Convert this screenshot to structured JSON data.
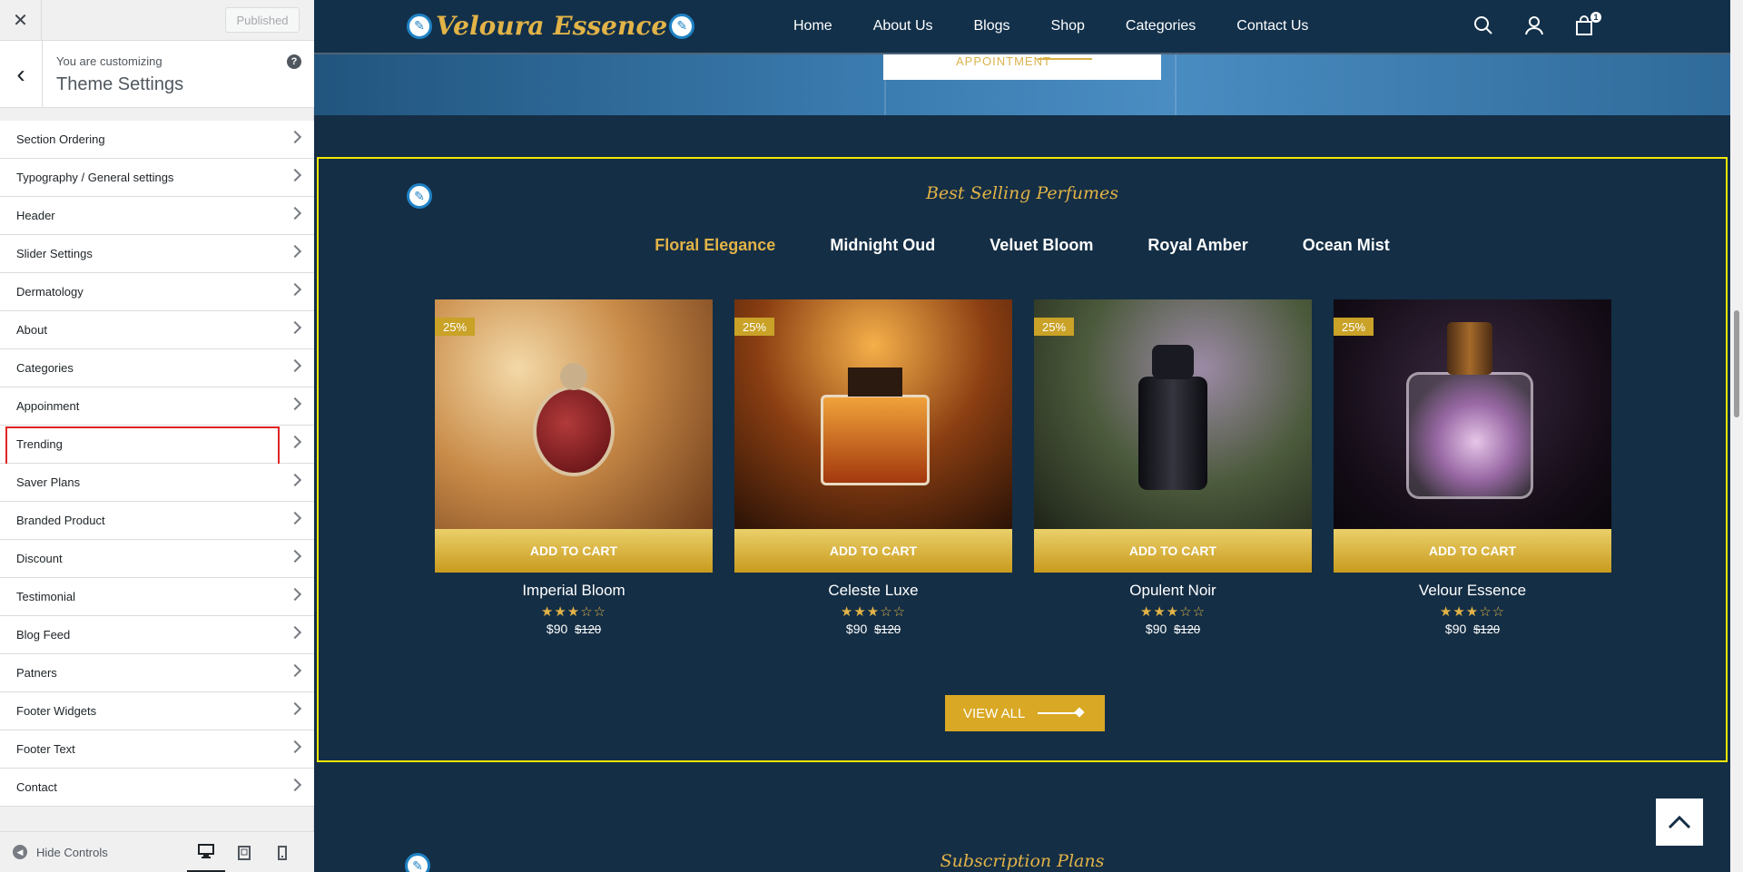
{
  "customizer": {
    "close_label": "✕",
    "published_label": "Published",
    "back_label": "‹",
    "customizing_label": "You are customizing",
    "theme_title": "Theme Settings",
    "help_label": "?",
    "sections": [
      {
        "label": "Section Ordering"
      },
      {
        "label": "Typography / General settings"
      },
      {
        "label": "Header"
      },
      {
        "label": "Slider Settings"
      },
      {
        "label": "Dermatology"
      },
      {
        "label": "About"
      },
      {
        "label": "Categories"
      },
      {
        "label": "Appoinment"
      },
      {
        "label": "Trending",
        "highlighted": true
      },
      {
        "label": "Saver Plans"
      },
      {
        "label": "Branded Product"
      },
      {
        "label": "Discount"
      },
      {
        "label": "Testimonial"
      },
      {
        "label": "Blog Feed"
      },
      {
        "label": "Patners"
      },
      {
        "label": "Footer Widgets"
      },
      {
        "label": "Footer Text"
      },
      {
        "label": "Contact"
      }
    ],
    "hide_controls_label": "Hide Controls",
    "devices": [
      "desktop-icon",
      "tablet-icon",
      "mobile-icon"
    ]
  },
  "site": {
    "logo": "Veloura Essence",
    "nav": [
      "Home",
      "About Us",
      "Blogs",
      "Shop",
      "Categories",
      "Contact Us"
    ],
    "cart_count": "1",
    "appointment_label": "APPOINTMENT",
    "colors": {
      "navy": "#142e45",
      "gold": "#e2b347",
      "highlight": "#f2e600"
    }
  },
  "best_selling": {
    "title": "Best Selling Perfumes",
    "tabs": [
      "Floral Elegance",
      "Midnight Oud",
      "Veluet Bloom",
      "Royal Amber",
      "Ocean Mist"
    ],
    "active_tab": "Floral Elegance",
    "products": [
      {
        "name": "Imperial Bloom",
        "discount": "25%",
        "add_to_cart": "ADD TO CART",
        "rating": 3,
        "price": "$90",
        "old_price": "$120"
      },
      {
        "name": "Celeste Luxe",
        "discount": "25%",
        "add_to_cart": "ADD TO CART",
        "rating": 3,
        "price": "$90",
        "old_price": "$120"
      },
      {
        "name": "Opulent Noir",
        "discount": "25%",
        "add_to_cart": "ADD TO CART",
        "rating": 3,
        "price": "$90",
        "old_price": "$120"
      },
      {
        "name": "Velour Essence",
        "discount": "25%",
        "add_to_cart": "ADD TO CART",
        "rating": 3,
        "price": "$90",
        "old_price": "$120"
      }
    ],
    "view_all_label": "VIEW ALL"
  },
  "subscription": {
    "title": "Subscription Plans"
  }
}
